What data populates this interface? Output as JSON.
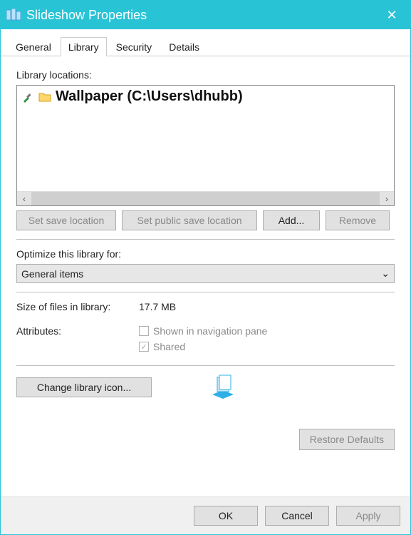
{
  "window": {
    "title": "Slideshow Properties"
  },
  "tabs": {
    "general": "General",
    "library": "Library",
    "security": "Security",
    "details": "Details",
    "active": "library"
  },
  "library": {
    "locations_label": "Library locations:",
    "items": [
      {
        "name": "Wallpaper (C:\\Users\\dhubb)"
      }
    ],
    "set_save": "Set save location",
    "set_public": "Set public save location",
    "add": "Add...",
    "remove": "Remove",
    "optimize_label": "Optimize this library for:",
    "optimize_value": "General items",
    "size_label": "Size of files in library:",
    "size_value": "17.7 MB",
    "attributes_label": "Attributes:",
    "shown_nav": "Shown in navigation pane",
    "shared": "Shared",
    "change_icon": "Change library icon...",
    "restore": "Restore Defaults"
  },
  "dialog": {
    "ok": "OK",
    "cancel": "Cancel",
    "apply": "Apply"
  }
}
